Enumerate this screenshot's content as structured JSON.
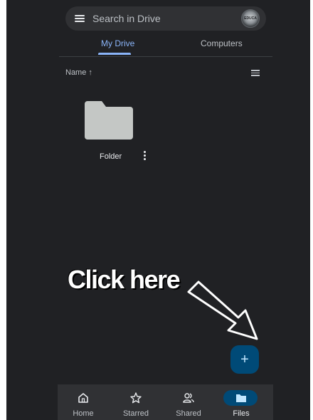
{
  "search": {
    "placeholder": "Search in Drive",
    "avatar_text": "EDUCA"
  },
  "tabs": [
    {
      "label": "My Drive",
      "active": true
    },
    {
      "label": "Computers",
      "active": false
    }
  ],
  "sort": {
    "label": "Name ↑"
  },
  "files": [
    {
      "name": "Folder",
      "type": "folder"
    }
  ],
  "annotation": {
    "text": "Click here"
  },
  "fab": {
    "icon": "+"
  },
  "bottom_nav": [
    {
      "label": "Home",
      "icon": "home-icon"
    },
    {
      "label": "Starred",
      "icon": "star-icon"
    },
    {
      "label": "Shared",
      "icon": "shared-people-icon"
    },
    {
      "label": "Files",
      "icon": "folder-icon",
      "active": true
    }
  ],
  "colors": {
    "background": "#202124",
    "accent": "#8ab4f8",
    "fab": "#004a77",
    "folder": "#c4c7c5"
  }
}
